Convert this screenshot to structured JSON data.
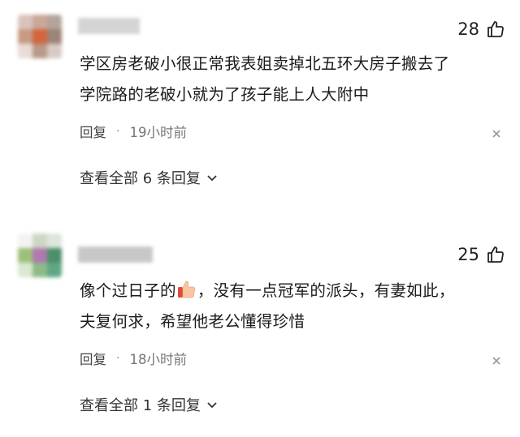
{
  "comments": [
    {
      "likes": "28",
      "text_lines": [
        "学区房老破小很正常我表姐卖掉北五环大房子搬去了",
        "学院路的老破小就为了孩子能上人大附中"
      ],
      "reply_label": "回复",
      "separator": "·",
      "time": "19小时前",
      "view_replies": "查看全部 6 条回复",
      "icons": {
        "like": "thumbs-up-icon",
        "close": "close-icon",
        "expand": "chevron-down-icon"
      }
    },
    {
      "likes": "25",
      "text_line1_before": "像个过日子的",
      "text_line1_after": "，没有一点冠军的派头，有妻如此，",
      "text_line2": "夫复何求，希望他老公懂得珍惜",
      "reply_label": "回复",
      "separator": "·",
      "time": "18小时前",
      "view_replies": "查看全部 1 条回复",
      "icons": {
        "like": "thumbs-up-icon",
        "emoji": "thumbs-up-emoji-icon",
        "close": "close-icon",
        "expand": "chevron-down-icon"
      }
    }
  ]
}
